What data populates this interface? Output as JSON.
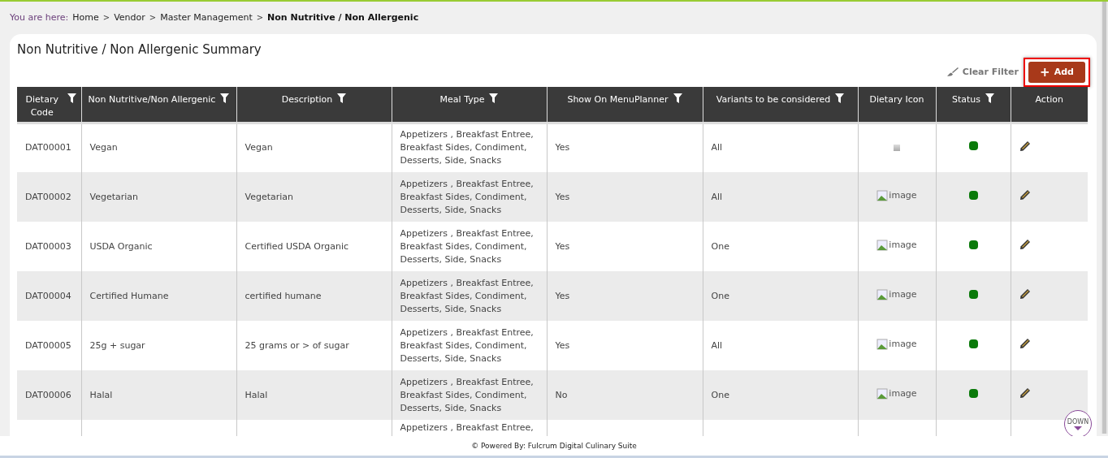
{
  "breadcrumb": {
    "prefix": "You are here:",
    "items": [
      {
        "label": "Home",
        "current": false
      },
      {
        "label": "Vendor",
        "current": false
      },
      {
        "label": "Master Management",
        "current": false
      },
      {
        "label": "Non Nutritive / Non Allergenic",
        "current": true
      }
    ],
    "separator": ">"
  },
  "title": "Non Nutritive / Non Allergenic Summary",
  "toolbar": {
    "clear_filter": "Clear Filter",
    "add": "Add",
    "add_icon": "+"
  },
  "table": {
    "columns": [
      {
        "label": "Dietary Code",
        "filter": true
      },
      {
        "label": "Non Nutritive/Non Allergenic",
        "filter": true
      },
      {
        "label": "Description",
        "filter": true
      },
      {
        "label": "Meal Type",
        "filter": true
      },
      {
        "label": "Show On MenuPlanner",
        "filter": true
      },
      {
        "label": "Variants to be considered",
        "filter": true
      },
      {
        "label": "Dietary Icon",
        "filter": false
      },
      {
        "label": "Status",
        "filter": true
      },
      {
        "label": "Action",
        "filter": false
      }
    ],
    "rows": [
      {
        "code": "DAT00001",
        "name": "Vegan",
        "description": "Vegan",
        "meal_type": "Appetizers , Breakfast Entree, Breakfast Sides, Condiment, Desserts, Side, Snacks",
        "show_on_menuplanner": "Yes",
        "variants": "All",
        "icon": {
          "kind": "thumb"
        },
        "active": true
      },
      {
        "code": "DAT00002",
        "name": "Vegetarian",
        "description": "Vegetarian",
        "meal_type": "Appetizers , Breakfast Entree, Breakfast Sides, Condiment, Desserts, Side, Snacks",
        "show_on_menuplanner": "Yes",
        "variants": "All",
        "icon": {
          "kind": "broken",
          "alt": "image"
        },
        "active": true
      },
      {
        "code": "DAT00003",
        "name": "USDA Organic",
        "description": "Certified USDA Organic",
        "meal_type": "Appetizers , Breakfast Entree, Breakfast Sides, Condiment, Desserts, Side, Snacks",
        "show_on_menuplanner": "Yes",
        "variants": "One",
        "icon": {
          "kind": "broken",
          "alt": "image"
        },
        "active": true
      },
      {
        "code": "DAT00004",
        "name": "Certified Humane",
        "description": "certified humane",
        "meal_type": "Appetizers , Breakfast Entree, Breakfast Sides, Condiment, Desserts, Side, Snacks",
        "show_on_menuplanner": "Yes",
        "variants": "One",
        "icon": {
          "kind": "broken",
          "alt": "image"
        },
        "active": true
      },
      {
        "code": "DAT00005",
        "name": "25g + sugar",
        "description": "25 grams or > of sugar",
        "meal_type": "Appetizers , Breakfast Entree, Breakfast Sides, Condiment, Desserts, Side, Snacks",
        "show_on_menuplanner": "Yes",
        "variants": "All",
        "icon": {
          "kind": "broken",
          "alt": "image"
        },
        "active": true
      },
      {
        "code": "DAT00006",
        "name": "Halal",
        "description": "Halal",
        "meal_type": "Appetizers , Breakfast Entree, Breakfast Sides, Condiment, Desserts, Side, Snacks",
        "show_on_menuplanner": "No",
        "variants": "One",
        "icon": {
          "kind": "broken",
          "alt": "image"
        },
        "active": true
      }
    ],
    "partial_row": {
      "meal_type": "Appetizers , Breakfast Entree,"
    }
  },
  "scroll_down": "DOWN",
  "footer": "© Powered By: Fulcrum Digital Culinary Suite"
}
